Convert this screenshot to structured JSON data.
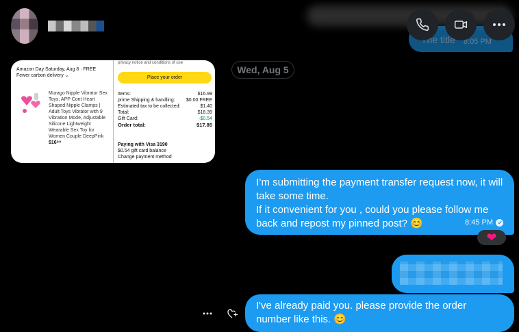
{
  "header": {
    "actions": [
      {
        "name": "phone-icon"
      },
      {
        "name": "video-icon"
      },
      {
        "name": "more-icon"
      }
    ]
  },
  "top_message": {
    "text": "The title",
    "time": "8:05 PM"
  },
  "date_separator": "Wed, Aug 5",
  "order_card": {
    "delivery_line": "Amazon Day Saturday, Aug 8 · FREE",
    "delivery_sub": "Fewer carbon delivery ⌄",
    "product": "Murago Nipple Vibrator Sex Toys, APP Cont Heart Shaped Nipple Clamps | Adult Toys Vibrator with 9 Vibration Mode, Adjustable Silicone Lightweight Wearable Sex Toy for Women Couple DeepPink",
    "price_short": "$16⁹⁹",
    "terms_top": "privacy notice and conditions of use",
    "place_order": "Place your order",
    "rows": [
      {
        "label": "Items:",
        "value": "$16.99"
      },
      {
        "label": "prime Shipping & handling:",
        "value": "$0.00 FREE"
      },
      {
        "label": "Estimated tax to be collected:",
        "value": "$1.40"
      },
      {
        "label": "Total:",
        "value": "$18.39"
      },
      {
        "label": "Gift Card:",
        "value": "-$0.54"
      }
    ],
    "order_total_label": "Order total:",
    "order_total_value": "$17.85",
    "paying_with": "Paying with Visa 3190",
    "gift_balance": "$0.54 gift card balance",
    "change_payment": "Change payment method"
  },
  "messages": [
    {
      "lines": [
        "I’m submitting the payment transfer request now, it will take some time.",
        "If it convenient for you , could you please follow me back and repost my pinned post? 😊"
      ],
      "time": "8:45 PM",
      "reaction": "❤"
    },
    {
      "text": "I've already paid you. please provide the order number like this. 😊"
    }
  ],
  "colors": {
    "bubble": "#1d9bf0",
    "background": "#000000",
    "reaction_heart": "#f91880"
  }
}
